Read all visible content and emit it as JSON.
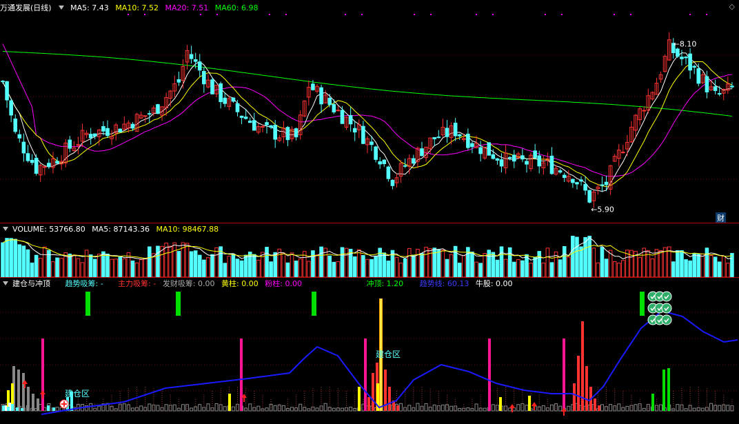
{
  "main": {
    "title": "万通发展(日线)",
    "ma5": "MA5: 7.43",
    "ma10": "MA10: 7.52",
    "ma20": "MA20: 7.51",
    "ma60": "MA60: 6.98",
    "high_label": "8.10",
    "low_label": "5.90",
    "finance_badge": "财"
  },
  "volume": {
    "label": "VOLUME: 53766.80",
    "ma5": "MA5: 87143.36",
    "ma10": "MA10: 98467.88"
  },
  "indicator": {
    "name": "建仓与冲顶",
    "trend_absorb": "趋势吸筹: -",
    "main_absorb": "主力吸筹: -",
    "fortune_absorb": "发财吸筹: 0.00",
    "yellow_col": "黄柱: 0.00",
    "pink_col": "粉柱: 0.00",
    "top_rush": "冲顶: 1.20",
    "trend_line": "趋势线: 60.13",
    "bull": "牛股: 0.00",
    "zone_label_1": "建仓区",
    "zone_label_2": "建仓区"
  },
  "colors": {
    "up": "#ff3232",
    "down": "#54ffff",
    "ma5": "#ffffff",
    "ma10": "#ffff00",
    "ma20": "#ff00ff",
    "ma60": "#00ff00",
    "separator": "#b00000",
    "trend": "#1a1aff"
  },
  "chart_data": {
    "type": "candlestick",
    "price_range": [
      5.9,
      8.1
    ],
    "indicator_values": {
      "trend_line": 60.13,
      "top_rush": 1.2
    }
  }
}
